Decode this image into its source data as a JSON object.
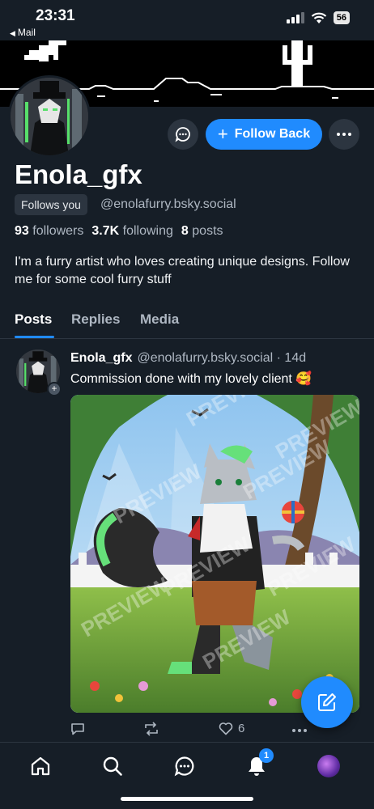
{
  "status_bar": {
    "time": "23:31",
    "back_app": "Mail",
    "battery": "56"
  },
  "profile": {
    "display_name": "Enola_gfx",
    "follows_you_label": "Follows you",
    "handle": "@enolafurry.bsky.social",
    "followers_count": "93",
    "followers_label": "followers",
    "following_count": "3.7K",
    "following_label": "following",
    "posts_count": "8",
    "posts_label": "posts",
    "bio": "I'm a furry artist who loves creating unique designs. Follow me for some cool furry stuff",
    "follow_back_label": "Follow Back"
  },
  "tabs": [
    {
      "label": "Posts",
      "active": true
    },
    {
      "label": "Replies",
      "active": false
    },
    {
      "label": "Media",
      "active": false
    }
  ],
  "post": {
    "author": "Enola_gfx",
    "handle": "@enolafurry.bsky.social",
    "time": "· 14d",
    "text": "Commission done with my lovely client 🥰",
    "like_count": "6",
    "image_watermark": "PREVIEW"
  },
  "nav": {
    "notification_count": "1"
  },
  "colors": {
    "accent": "#208bfe",
    "background": "#161e27",
    "secondary_text": "#aeb7c2"
  },
  "icons": [
    "chat-icon",
    "plus-icon",
    "more-icon",
    "reply-icon",
    "repost-icon",
    "heart-icon",
    "compose-icon",
    "home-icon",
    "search-icon",
    "messages-icon",
    "bell-icon"
  ]
}
